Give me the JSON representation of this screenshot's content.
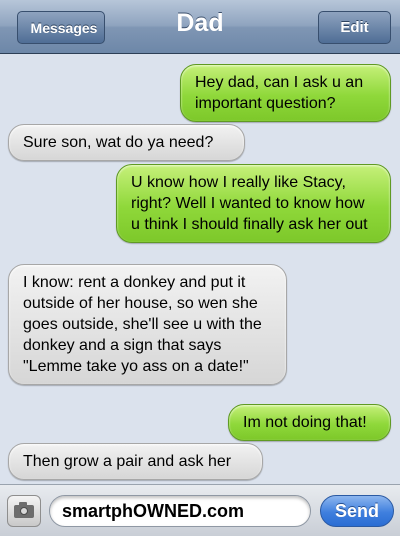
{
  "navbar": {
    "back_label": "Messages",
    "title": "Dad",
    "edit_label": "Edit"
  },
  "messages": [
    {
      "from": "me",
      "text": "Hey dad, can I ask u an important question?"
    },
    {
      "from": "dad",
      "text": "Sure son, wat do ya need?"
    },
    {
      "from": "me",
      "text": "U know how I really like Stacy, right? Well I wanted to know how u think I should finally ask her out"
    },
    {
      "from": "dad",
      "text": "I know: rent a donkey and put it outside of her house, so wen she goes outside, she'll see u with the donkey and a sign that says \"Lemme take yo ass on a date!\""
    },
    {
      "from": "me",
      "text": "Im not doing that!"
    },
    {
      "from": "dad",
      "text": "Then grow a pair and ask her"
    }
  ],
  "input_bar": {
    "camera_icon": "camera-icon",
    "field_value": "smartphOWNED.com",
    "send_label": "Send"
  },
  "colors": {
    "sent_bubble": "#8fd83a",
    "received_bubble": "#e1e1e1",
    "navbar": "#7f96b4",
    "background": "#dbe2ed",
    "send_button": "#3f7fde"
  }
}
